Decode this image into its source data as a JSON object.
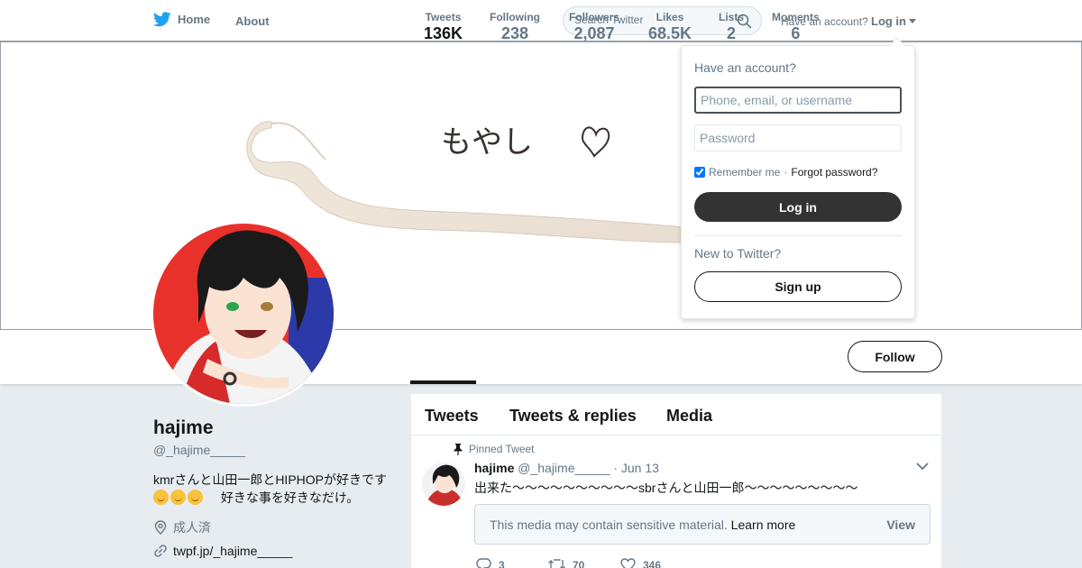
{
  "colors": {
    "brand": "#1da1f2",
    "button_dark": "#333333",
    "muted": "#657786",
    "text": "#14171a",
    "background": "#e6ecf0"
  },
  "nav": {
    "home_label": "Home",
    "about_label": "About",
    "search_placeholder": "Search Twitter",
    "have_account": "Have an account?",
    "login_label": "Log in"
  },
  "banner": {
    "handwriting": "もやし"
  },
  "stats": [
    {
      "label": "Tweets",
      "value": "136K"
    },
    {
      "label": "Following",
      "value": "238"
    },
    {
      "label": "Followers",
      "value": "2,087"
    },
    {
      "label": "Likes",
      "value": "68.5K"
    },
    {
      "label": "Lists",
      "value": "2"
    },
    {
      "label": "Moments",
      "value": "6"
    }
  ],
  "follow_label": "Follow",
  "profile": {
    "name": "hajime",
    "handle": "@_hajime_____",
    "bio_line1": "kmrさんと山田一郎とHIPHOPが好きです",
    "bio_line2": "好きな事を好きなだけ。",
    "location": "成人済",
    "url": "twpf.jp/_hajime_____"
  },
  "timeline": {
    "tabs": [
      "Tweets",
      "Tweets & replies",
      "Media"
    ],
    "pinned_label": "Pinned Tweet",
    "tweet": {
      "name": "hajime",
      "handle": "@_hajime_____",
      "date": "· Jun 13",
      "text": "出来た～～～～～～～～～～sbrさんと山田一郎～～～～～～～～～",
      "sensitive_msg": "This media may contain sensitive material.",
      "learn_more": "Learn more",
      "view_label": "View",
      "replies": "3",
      "retweets": "70",
      "likes": "346"
    }
  },
  "login_dropdown": {
    "title": "Have an account?",
    "username_placeholder": "Phone, email, or username",
    "password_placeholder": "Password",
    "remember_label": "Remember me",
    "separator": "·",
    "forgot_label": "Forgot password?",
    "login_button": "Log in",
    "new_label": "New to Twitter?",
    "signup_button": "Sign up"
  }
}
